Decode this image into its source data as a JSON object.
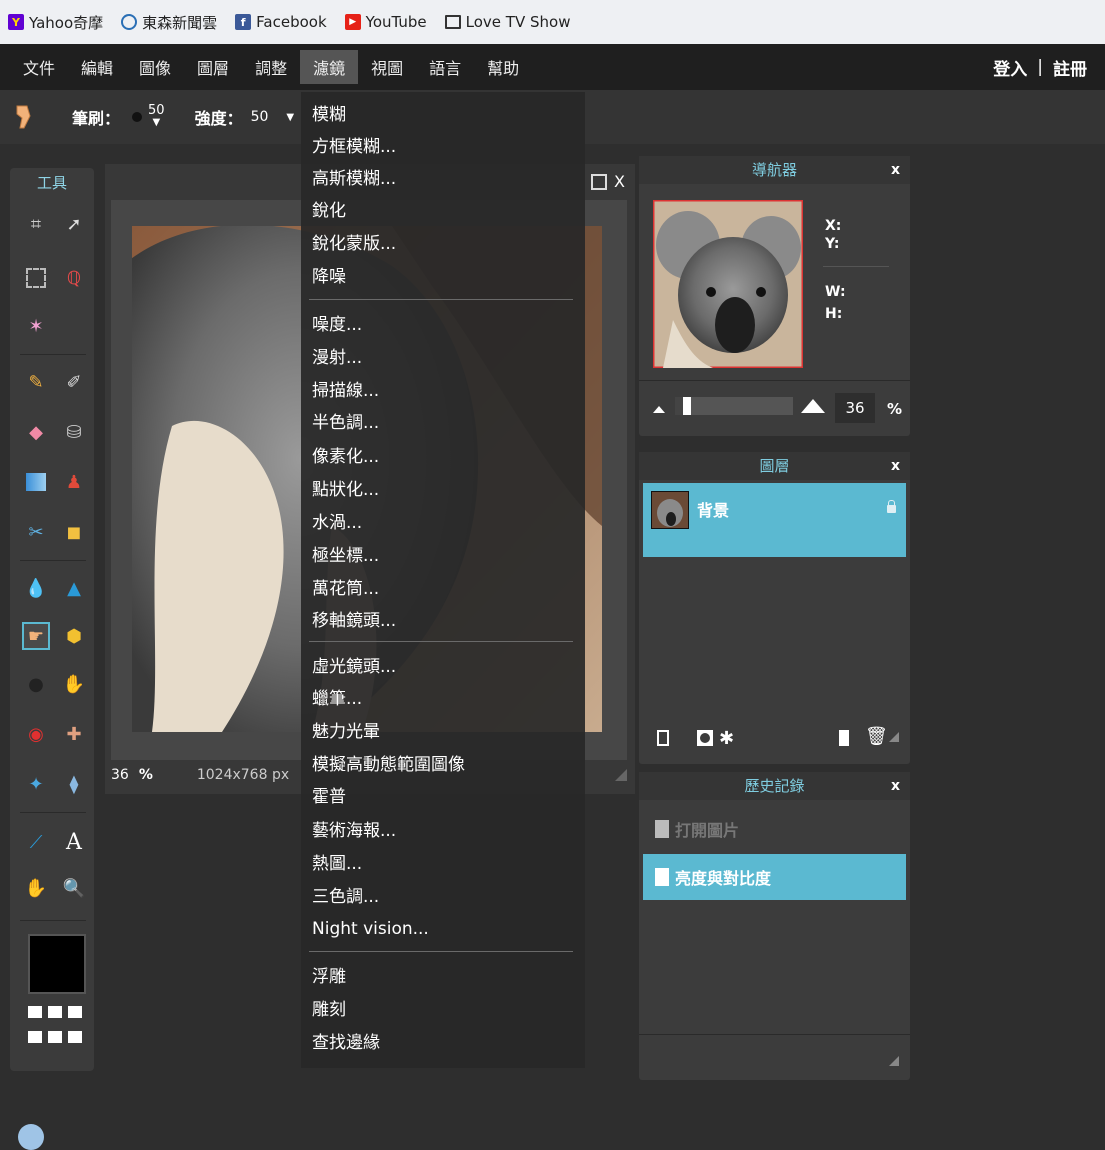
{
  "bookmarks": [
    {
      "label": "Yahoo奇摩",
      "icon": "yahoo-icon",
      "color": "#6001d2"
    },
    {
      "label": "東森新聞雲",
      "icon": "ettoday-icon",
      "color": "#2a6fb5"
    },
    {
      "label": "Facebook",
      "icon": "facebook-icon",
      "color": "#3b5998"
    },
    {
      "label": "YouTube",
      "icon": "youtube-icon",
      "color": "#e62117"
    },
    {
      "label": "Love TV Show",
      "icon": "tv-icon",
      "color": "#333333"
    }
  ],
  "menubar": {
    "items": [
      "文件",
      "編輯",
      "圖像",
      "圖層",
      "調整",
      "濾鏡",
      "視圖",
      "語言",
      "幫助"
    ],
    "active": "濾鏡",
    "login": "登入",
    "divider": "|",
    "register": "註冊"
  },
  "options": {
    "brush_label": "筆刷：",
    "brush_size": "50",
    "strength_label": "強度：",
    "strength_value": "50"
  },
  "tools": {
    "title": "工具"
  },
  "image_window": {
    "close": "X",
    "zoom": "36",
    "zoom_unit": "%",
    "dimensions": "1024x768 px"
  },
  "filter_menu": {
    "groups": [
      [
        "模糊",
        "方框模糊...",
        "高斯模糊...",
        "銳化",
        "銳化蒙版...",
        "降噪"
      ],
      [
        "噪度...",
        "漫射...",
        "掃描線...",
        "半色調...",
        "像素化...",
        "點狀化...",
        "水渦...",
        "極坐標...",
        "萬花筒...",
        "移軸鏡頭..."
      ],
      [
        "虛光鏡頭...",
        "蠟筆...",
        "魅力光暈",
        "模擬高動態範圍圖像",
        "霍普",
        "藝術海報...",
        "熱圖...",
        "三色調...",
        "Night vision..."
      ],
      [
        "浮雕",
        "雕刻",
        "查找邊緣"
      ]
    ]
  },
  "navigator": {
    "title": "導航器",
    "close": "x",
    "x_label": "X:",
    "y_label": "Y:",
    "w_label": "W:",
    "h_label": "H:",
    "zoom": "36",
    "zoom_unit": "%",
    "zoom_level": 0.02
  },
  "layers": {
    "title": "圖層",
    "close": "x",
    "items": [
      {
        "name": "背景",
        "locked": true
      }
    ]
  },
  "history": {
    "title": "歷史記錄",
    "close": "x",
    "items": [
      {
        "label": "打開圖片",
        "active": false
      },
      {
        "label": "亮度與對比度",
        "active": true
      }
    ]
  },
  "colors": {
    "accent": "#5bb9d1",
    "panel_title": "#7fcde0",
    "foreground": "#000000"
  }
}
